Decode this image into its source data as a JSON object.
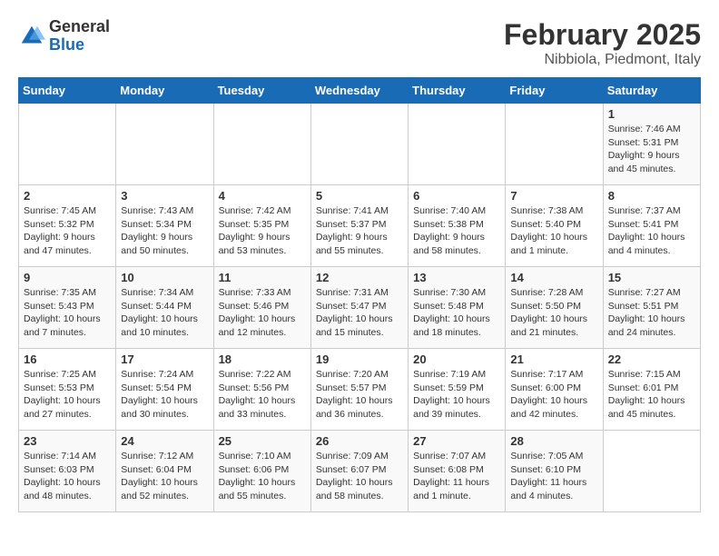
{
  "logo": {
    "general": "General",
    "blue": "Blue"
  },
  "title": "February 2025",
  "subtitle": "Nibbiola, Piedmont, Italy",
  "weekdays": [
    "Sunday",
    "Monday",
    "Tuesday",
    "Wednesday",
    "Thursday",
    "Friday",
    "Saturday"
  ],
  "weeks": [
    [
      {
        "day": "",
        "info": ""
      },
      {
        "day": "",
        "info": ""
      },
      {
        "day": "",
        "info": ""
      },
      {
        "day": "",
        "info": ""
      },
      {
        "day": "",
        "info": ""
      },
      {
        "day": "",
        "info": ""
      },
      {
        "day": "1",
        "info": "Sunrise: 7:46 AM\nSunset: 5:31 PM\nDaylight: 9 hours and 45 minutes."
      }
    ],
    [
      {
        "day": "2",
        "info": "Sunrise: 7:45 AM\nSunset: 5:32 PM\nDaylight: 9 hours and 47 minutes."
      },
      {
        "day": "3",
        "info": "Sunrise: 7:43 AM\nSunset: 5:34 PM\nDaylight: 9 hours and 50 minutes."
      },
      {
        "day": "4",
        "info": "Sunrise: 7:42 AM\nSunset: 5:35 PM\nDaylight: 9 hours and 53 minutes."
      },
      {
        "day": "5",
        "info": "Sunrise: 7:41 AM\nSunset: 5:37 PM\nDaylight: 9 hours and 55 minutes."
      },
      {
        "day": "6",
        "info": "Sunrise: 7:40 AM\nSunset: 5:38 PM\nDaylight: 9 hours and 58 minutes."
      },
      {
        "day": "7",
        "info": "Sunrise: 7:38 AM\nSunset: 5:40 PM\nDaylight: 10 hours and 1 minute."
      },
      {
        "day": "8",
        "info": "Sunrise: 7:37 AM\nSunset: 5:41 PM\nDaylight: 10 hours and 4 minutes."
      }
    ],
    [
      {
        "day": "9",
        "info": "Sunrise: 7:35 AM\nSunset: 5:43 PM\nDaylight: 10 hours and 7 minutes."
      },
      {
        "day": "10",
        "info": "Sunrise: 7:34 AM\nSunset: 5:44 PM\nDaylight: 10 hours and 10 minutes."
      },
      {
        "day": "11",
        "info": "Sunrise: 7:33 AM\nSunset: 5:46 PM\nDaylight: 10 hours and 12 minutes."
      },
      {
        "day": "12",
        "info": "Sunrise: 7:31 AM\nSunset: 5:47 PM\nDaylight: 10 hours and 15 minutes."
      },
      {
        "day": "13",
        "info": "Sunrise: 7:30 AM\nSunset: 5:48 PM\nDaylight: 10 hours and 18 minutes."
      },
      {
        "day": "14",
        "info": "Sunrise: 7:28 AM\nSunset: 5:50 PM\nDaylight: 10 hours and 21 minutes."
      },
      {
        "day": "15",
        "info": "Sunrise: 7:27 AM\nSunset: 5:51 PM\nDaylight: 10 hours and 24 minutes."
      }
    ],
    [
      {
        "day": "16",
        "info": "Sunrise: 7:25 AM\nSunset: 5:53 PM\nDaylight: 10 hours and 27 minutes."
      },
      {
        "day": "17",
        "info": "Sunrise: 7:24 AM\nSunset: 5:54 PM\nDaylight: 10 hours and 30 minutes."
      },
      {
        "day": "18",
        "info": "Sunrise: 7:22 AM\nSunset: 5:56 PM\nDaylight: 10 hours and 33 minutes."
      },
      {
        "day": "19",
        "info": "Sunrise: 7:20 AM\nSunset: 5:57 PM\nDaylight: 10 hours and 36 minutes."
      },
      {
        "day": "20",
        "info": "Sunrise: 7:19 AM\nSunset: 5:59 PM\nDaylight: 10 hours and 39 minutes."
      },
      {
        "day": "21",
        "info": "Sunrise: 7:17 AM\nSunset: 6:00 PM\nDaylight: 10 hours and 42 minutes."
      },
      {
        "day": "22",
        "info": "Sunrise: 7:15 AM\nSunset: 6:01 PM\nDaylight: 10 hours and 45 minutes."
      }
    ],
    [
      {
        "day": "23",
        "info": "Sunrise: 7:14 AM\nSunset: 6:03 PM\nDaylight: 10 hours and 48 minutes."
      },
      {
        "day": "24",
        "info": "Sunrise: 7:12 AM\nSunset: 6:04 PM\nDaylight: 10 hours and 52 minutes."
      },
      {
        "day": "25",
        "info": "Sunrise: 7:10 AM\nSunset: 6:06 PM\nDaylight: 10 hours and 55 minutes."
      },
      {
        "day": "26",
        "info": "Sunrise: 7:09 AM\nSunset: 6:07 PM\nDaylight: 10 hours and 58 minutes."
      },
      {
        "day": "27",
        "info": "Sunrise: 7:07 AM\nSunset: 6:08 PM\nDaylight: 11 hours and 1 minute."
      },
      {
        "day": "28",
        "info": "Sunrise: 7:05 AM\nSunset: 6:10 PM\nDaylight: 11 hours and 4 minutes."
      },
      {
        "day": "",
        "info": ""
      }
    ]
  ]
}
